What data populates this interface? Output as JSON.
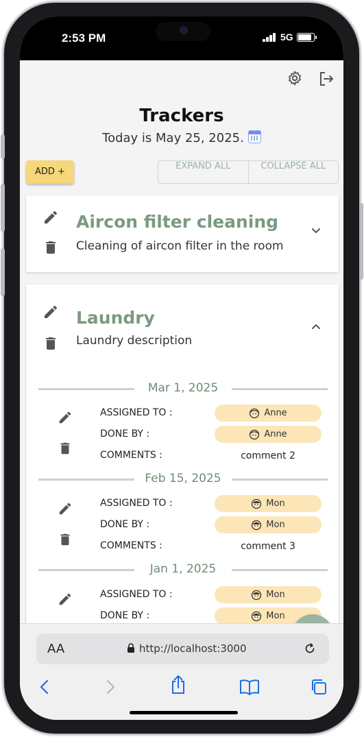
{
  "status_bar": {
    "time": "2:53 PM",
    "network": "5G"
  },
  "page": {
    "title": "Trackers",
    "subtitle": "Today is May 25, 2025.",
    "add_button": "ADD +",
    "expand_all": "EXPAND ALL",
    "collapse_all": "COLLAPSE ALL"
  },
  "trackers": [
    {
      "name": "Aircon filter cleaning",
      "description": "Cleaning of aircon filter in the room",
      "expanded": false
    },
    {
      "name": "Laundry",
      "description": "Laundry description",
      "expanded": true,
      "entries": [
        {
          "date": "Mar 1, 2025",
          "assigned_to_label": "ASSIGNED TO :",
          "assigned_to": "Anne",
          "done_by_label": "DONE BY :",
          "done_by": "Anne",
          "comments_label": "COMMENTS :",
          "comments": "comment 2"
        },
        {
          "date": "Feb 15, 2025",
          "assigned_to_label": "ASSIGNED TO :",
          "assigned_to": "Mon",
          "done_by_label": "DONE BY :",
          "done_by": "Mon",
          "comments_label": "COMMENTS :",
          "comments": "comment 3"
        },
        {
          "date": "Jan 1, 2025",
          "assigned_to_label": "ASSIGNED TO :",
          "assigned_to": "Mon",
          "done_by_label": "DONE BY :",
          "done_by": "Mon"
        }
      ]
    }
  ],
  "browser": {
    "text_size_label": "AA",
    "url": "http://localhost:3000"
  },
  "colors": {
    "accent_green": "#7b9a80",
    "add_button": "#f6d779",
    "pill": "#fce6b8",
    "fab": "#9bb3a1"
  },
  "icons": [
    "settings-icon",
    "logout-icon",
    "calendar-icon",
    "edit-icon",
    "delete-icon",
    "chevron-down-icon",
    "chevron-up-icon",
    "avatar-face-icon",
    "menu-icon",
    "lock-icon",
    "reload-icon",
    "back-icon",
    "forward-icon",
    "share-icon",
    "bookmarks-icon",
    "tabs-icon"
  ]
}
